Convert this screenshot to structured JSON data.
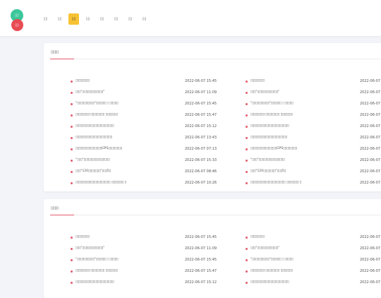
{
  "header": {
    "logo_top": "▯▯",
    "logo_bottom": "▯▯",
    "nav": [
      "▯▯",
      "▯▯",
      "▯▯",
      "▯▯",
      "▯▯",
      "▯▯",
      "▯▯",
      "▯▯"
    ],
    "active_nav_index": 2
  },
  "cards": [
    {
      "title": "▯▯▯▯",
      "items": [
        {
          "text": "▯▯▯▯▯▯▯▯",
          "date": "2022-06-07 15:45"
        },
        {
          "text": "▯▯▯\"▯▯▯▯▯▯▯▯▯▯▯▯\"",
          "date": "2022-06-07 11:09"
        },
        {
          "text": "\"▯▯▯▯▯▯▯▯▯▯\"▯▯▯▯▯▯ | ▯▯▯▯▯",
          "date": "2022-06-07 15:45"
        },
        {
          "text": "▯▯▯▯▯▯▯▯·▯▯▯▯▯▯▯▯ ▯▯▯▯▯▯▯",
          "date": "2022-06-07 15:47"
        },
        {
          "text": "▯▯▯▯▯▯▯▯▯▯▯▯▯▯▯▯▯▯▯▯▯▯",
          "date": "2022-06-07 15:12"
        },
        {
          "text": "▯▯▯▯▯▯▯▯▯▯▯▯▯▯▯▯▯▯▯▯▯",
          "date": "2022-06-07 13:43"
        },
        {
          "text": "▯▯▯▯▯▯▯▯▯▯▯▯▯▯▯GPS▯▯▯▯▯▯▯▯",
          "date": "2022-06-07 07:13"
        },
        {
          "text": "\"▯▯▯\"▯▯▯▯▯▯▯▯▯▯▯▯▯▯▯",
          "date": "2022-06-07 15:33"
        },
        {
          "text": "▯▯▯\"120▯▯▯▯▯▯▯\"▯▯▯5▯",
          "date": "2022-06-07 08:46"
        },
        {
          "text": "▯▯▯▯▯▯▯▯▯▯▯▯▯▯▯▯▯▯▯▯ ▯▯▯▯▯▯▯ ▯",
          "date": "2022-06-07 10:26"
        }
      ]
    },
    {
      "title": "▯▯▯▯",
      "items": [
        {
          "text": "▯▯▯▯▯▯▯▯",
          "date": "2022-06-07 15:45"
        },
        {
          "text": "▯▯▯\"▯▯▯▯▯▯▯▯▯▯▯▯\"",
          "date": "2022-06-07 11:09"
        },
        {
          "text": "\"▯▯▯▯▯▯▯▯▯▯\"▯▯▯▯▯▯ | ▯▯▯▯▯",
          "date": "2022-06-07 15:45"
        },
        {
          "text": "▯▯▯▯▯▯▯▯·▯▯▯▯▯▯▯▯ ▯▯▯▯▯▯▯",
          "date": "2022-06-07 15:47"
        },
        {
          "text": "▯▯▯▯▯▯▯▯▯▯▯▯▯▯▯▯▯▯▯▯▯▯",
          "date": "2022-06-07 15:12"
        }
      ]
    }
  ],
  "right_date": "2022-06-07"
}
